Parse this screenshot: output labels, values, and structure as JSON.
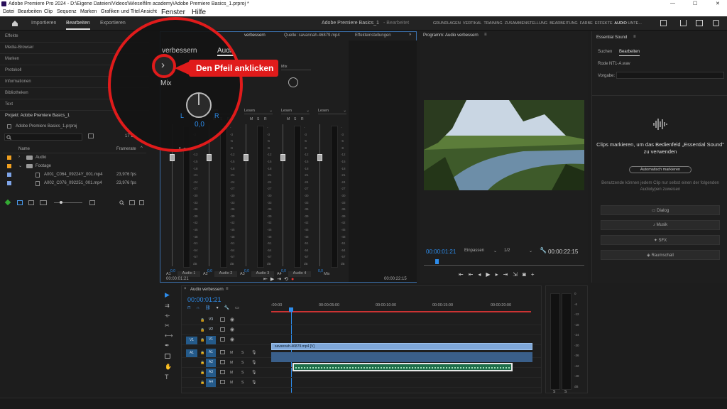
{
  "window": {
    "title": "Adobe Premiere Pro 2024 - D:\\Eigene Dateien\\Videos\\Wieselfilm academy\\Adobe Premiere Basics_1.prproj *",
    "minimize": "—",
    "maximize": "☐",
    "close": "✕"
  },
  "menu": {
    "items": [
      "Datei",
      "Bearbeiten",
      "Clip",
      "Sequenz",
      "Marken",
      "Grafiken und Titel",
      "Ansicht",
      "Fenster",
      "Hilfe"
    ]
  },
  "header": {
    "tabs": [
      "Importieren",
      "Bearbeiten",
      "Exportieren"
    ],
    "active_tab": "Bearbeiten",
    "project_title": "Adobe Premiere Basics_1",
    "project_sub": "- Bearbeitet",
    "workspaces": [
      "GRUNDLAGEN",
      "VERTIKAL",
      "TRAINING",
      "ZUSAMMENSTELLUNG",
      "BEARBEITUNG",
      "FARBE",
      "EFFEKTE",
      "AUDIO",
      "UNTE..."
    ],
    "active_workspace": "AUDIO"
  },
  "left_panels": [
    "Effekte",
    "Media-Browser",
    "Marken",
    "Protokoll",
    "Informationen",
    "Bibliotheken",
    "Text"
  ],
  "project": {
    "label": "Projekt: Adobe Premiere Basics_1",
    "file": "Adobe Premiere Basics_1.prproj",
    "count": "17 Ele",
    "col_name": "Name",
    "col_fps": "Framerate",
    "items": [
      {
        "name": "Audio",
        "fps": ""
      },
      {
        "name": "Footage",
        "fps": ""
      },
      {
        "name": "A001_C064_09224Y_001.mp4",
        "fps": "23,976 fps"
      },
      {
        "name": "A002_C076_092251_001.mp4",
        "fps": "23,976 fps"
      }
    ]
  },
  "mixer": {
    "tabs": [
      "Audiospur-Mixer: Audio verbessern",
      "Quelle: savannah-46879.mp4",
      "Effekteinstellungen"
    ],
    "tab_short": "verbessern",
    "panel_label": "verbessern",
    "mixer_label": "Audiospur-",
    "read_modes": [
      "Lesen",
      "Lesen",
      "Lesen",
      "Lesen"
    ],
    "mix_label": "Mix",
    "mix_big": "Mix",
    "lesen_big": "Lesen",
    "pan_value": "0,0",
    "l": "L",
    "r": "R",
    "m": "M",
    "s": "S",
    "db_scale": [
      "-",
      "-3",
      "-6",
      "-9",
      "-12",
      "-15",
      "-18",
      "-21",
      "-24",
      "-27",
      "-30",
      "-33",
      "-36",
      "-39",
      "-42",
      "-45",
      "-48",
      "-51",
      "-54",
      "-57",
      "dB"
    ],
    "values": [
      "0,0",
      "0,0",
      "0,0",
      "0,0",
      "0,0"
    ],
    "channels": [
      {
        "id": "A1",
        "name": "Audio 1"
      },
      {
        "id": "A2",
        "name": "Audio 2"
      },
      {
        "id": "A3",
        "name": "Audio 3"
      },
      {
        "id": "A4",
        "name": "Audio 4"
      }
    ],
    "master": "Mix",
    "time_left": "00:00:01:21",
    "time_right": "00:00:22:15"
  },
  "callout": {
    "text": "Den Pfeil anklicken",
    "arrow": "›"
  },
  "program": {
    "title": "Programm: Audio verbessern",
    "timecode": "00:00:01:21",
    "fit": "Einpassen",
    "res": "1/2",
    "duration": "00:00:22:15"
  },
  "essential": {
    "title": "Essential Sound",
    "tabs": [
      "Suchen",
      "Bearbeiten"
    ],
    "file": "Rode NT1-A.wav",
    "preset_label": "Vorgabe:",
    "headline": "Clips markieren, um das Bedienfeld „Essential Sound“ zu verwenden",
    "auto_btn": "Automatisch markieren",
    "hint": "Benutzende können jedem Clip nur selbst einen der folgenden Audiotypen zuweisen",
    "types": [
      "Dialog",
      "Musik",
      "SFX",
      "Raumschall"
    ]
  },
  "timeline": {
    "title": "Audio verbessern",
    "timecode": "00:00:01:21",
    "ruler": [
      ":00:00",
      "00:00:05:00",
      "00:00:10:00",
      "00:00:15:00",
      "00:00:20:00"
    ],
    "video_tracks": [
      "V3",
      "V2",
      "V1"
    ],
    "audio_tracks": [
      "A1",
      "A2",
      "A3",
      "A4"
    ],
    "src_v": "V1",
    "src_a": "A1",
    "clip_label": "savannah-46879.mp4 [V]",
    "m": "M",
    "s": "S"
  },
  "level_meter": {
    "scale": [
      "0",
      "-6",
      "-12",
      "-18",
      "-24",
      "-30",
      "-36",
      "-42",
      "-48",
      "dB"
    ],
    "s": "S"
  }
}
